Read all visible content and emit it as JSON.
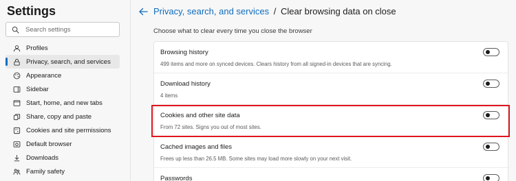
{
  "sidebar": {
    "title": "Settings",
    "search_placeholder": "Search settings",
    "items": [
      {
        "label": "Profiles",
        "icon": "profile-icon"
      },
      {
        "label": "Privacy, search, and services",
        "icon": "lock-icon",
        "active": true
      },
      {
        "label": "Appearance",
        "icon": "appearance-icon"
      },
      {
        "label": "Sidebar",
        "icon": "sidebar-icon"
      },
      {
        "label": "Start, home, and new tabs",
        "icon": "home-icon"
      },
      {
        "label": "Share, copy and paste",
        "icon": "share-icon"
      },
      {
        "label": "Cookies and site permissions",
        "icon": "cookies-icon"
      },
      {
        "label": "Default browser",
        "icon": "browser-icon"
      },
      {
        "label": "Downloads",
        "icon": "download-icon"
      },
      {
        "label": "Family safety",
        "icon": "family-icon"
      }
    ]
  },
  "main": {
    "breadcrumb_link": "Privacy, search, and services",
    "breadcrumb_sep": "/",
    "breadcrumb_current": "Clear browsing data on close",
    "subtitle": "Choose what to clear every time you close the browser",
    "rows": [
      {
        "title": "Browsing history",
        "desc": "499 items and more on synced devices. Clears history from all signed-in devices that are syncing.",
        "enabled": false
      },
      {
        "title": "Download history",
        "desc": "4 items",
        "enabled": false
      },
      {
        "title": "Cookies and other site data",
        "desc": "From 72 sites. Signs you out of most sites.",
        "enabled": false,
        "highlighted": true
      },
      {
        "title": "Cached images and files",
        "desc": "Frees up less than 26.5 MB. Some sites may load more slowly on your next visit.",
        "enabled": false
      },
      {
        "title": "Passwords",
        "desc": "",
        "enabled": false
      }
    ]
  },
  "colors": {
    "accent": "#0f6cbd",
    "highlight": "#e0141e"
  }
}
